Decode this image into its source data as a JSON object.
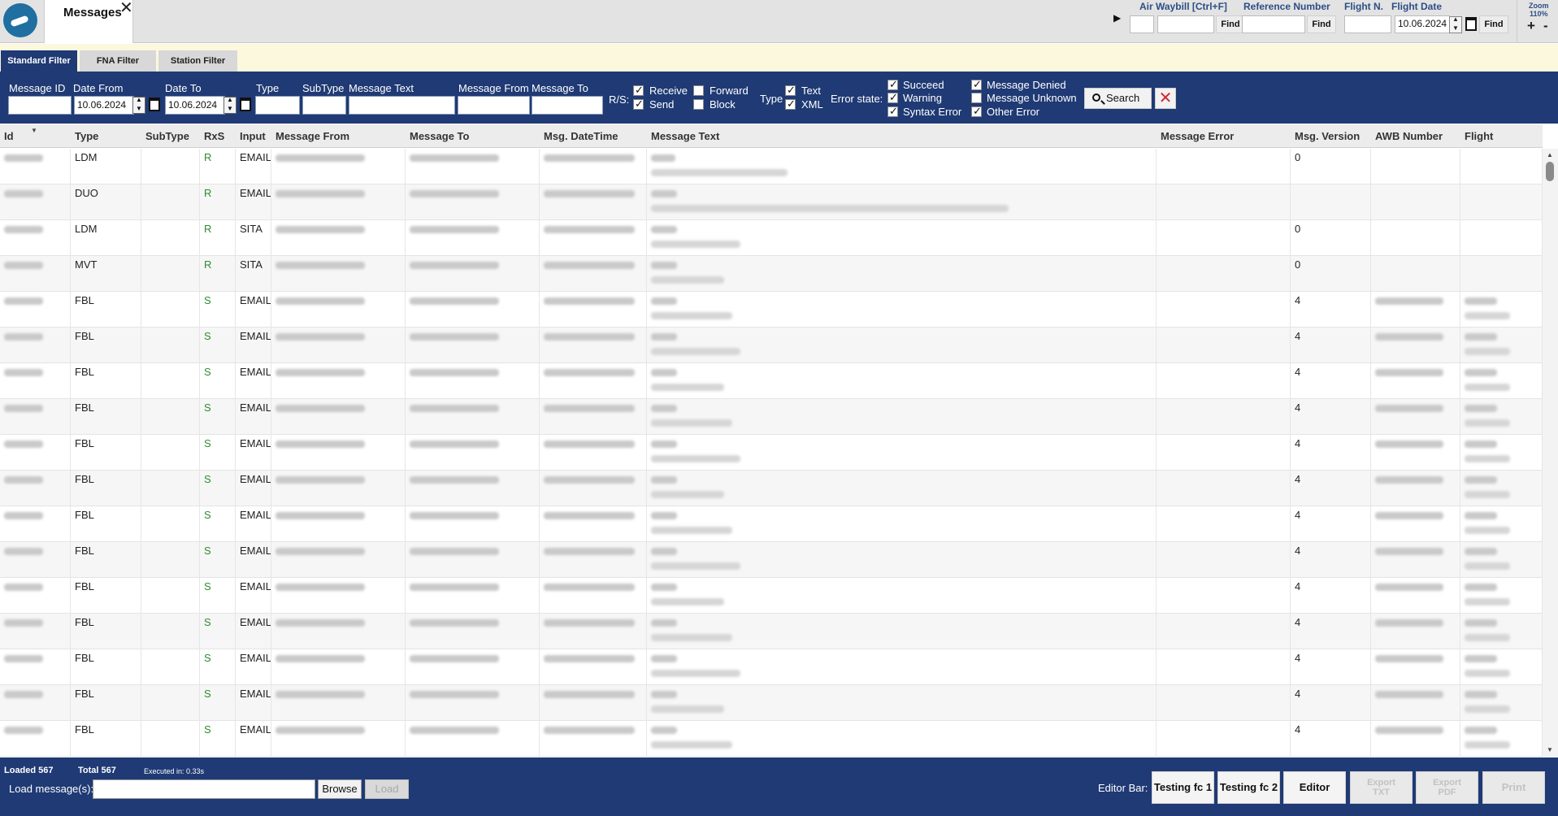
{
  "tab": {
    "title": "Messages",
    "close": "✕"
  },
  "tools": {
    "arrow": "▶",
    "awb_label": "Air Waybill [Ctrl+F]",
    "ref_label": "Reference Number",
    "flight_no_label": "Flight N.",
    "flight_date_label": "Flight Date",
    "flight_date_value": "10.06.2024",
    "find": "Find",
    "zoom_label": "Zoom",
    "zoom_value": "110%",
    "zoom_plus": "+",
    "zoom_minus": "-"
  },
  "filter_tabs": [
    "Standard Filter",
    "FNA Filter",
    "Station Filter"
  ],
  "filter": {
    "message_id": "Message ID",
    "date_from": "Date From",
    "date_from_value": "10.06.2024",
    "date_to": "Date To",
    "date_to_value": "10.06.2024",
    "type": "Type",
    "subtype": "SubType",
    "message_text": "Message Text",
    "message_from": "Message From",
    "message_to": "Message To",
    "rs_label": "R/S:",
    "receive": "Receive",
    "send": "Send",
    "forward": "Forward",
    "block": "Block",
    "type_label": "Type",
    "text": "Text",
    "xml": "XML",
    "error_state": "Error state:",
    "succeed": "Succeed",
    "warning": "Warning",
    "syntax_error": "Syntax Error",
    "message_denied": "Message Denied",
    "message_unknown": "Message Unknown",
    "other_error": "Other Error",
    "search": "Search",
    "clear": "✕"
  },
  "checkbox_state": {
    "receive": true,
    "send": true,
    "forward": false,
    "block": false,
    "text": true,
    "xml": true,
    "succeed": true,
    "warning": true,
    "syntax_error": true,
    "message_denied": true,
    "message_unknown": false,
    "other_error": true
  },
  "columns": [
    "Id",
    "Type",
    "SubType",
    "RxS",
    "Input",
    "Message From",
    "Message To",
    "Msg. DateTime",
    "Message Text",
    "Message Error",
    "Msg. Version",
    "AWB Number",
    "Flight"
  ],
  "rows": [
    {
      "type": "LDM",
      "subtype": "",
      "rxs": "R",
      "input": "EMAIL",
      "error": "",
      "version": "0"
    },
    {
      "type": "DUO",
      "subtype": "",
      "rxs": "R",
      "input": "EMAIL",
      "error": "",
      "version": ""
    },
    {
      "type": "LDM",
      "subtype": "",
      "rxs": "R",
      "input": "SITA",
      "error": "",
      "version": "0"
    },
    {
      "type": "MVT",
      "subtype": "",
      "rxs": "R",
      "input": "SITA",
      "error": "",
      "version": "0"
    },
    {
      "type": "FBL",
      "subtype": "",
      "rxs": "S",
      "input": "EMAIL",
      "error": "",
      "version": "4"
    },
    {
      "type": "FBL",
      "subtype": "",
      "rxs": "S",
      "input": "EMAIL",
      "error": "",
      "version": "4"
    },
    {
      "type": "FBL",
      "subtype": "",
      "rxs": "S",
      "input": "EMAIL",
      "error": "",
      "version": "4"
    },
    {
      "type": "FBL",
      "subtype": "",
      "rxs": "S",
      "input": "EMAIL",
      "error": "",
      "version": "4"
    },
    {
      "type": "FBL",
      "subtype": "",
      "rxs": "S",
      "input": "EMAIL",
      "error": "",
      "version": "4"
    },
    {
      "type": "FBL",
      "subtype": "",
      "rxs": "S",
      "input": "EMAIL",
      "error": "",
      "version": "4"
    },
    {
      "type": "FBL",
      "subtype": "",
      "rxs": "S",
      "input": "EMAIL",
      "error": "",
      "version": "4"
    },
    {
      "type": "FBL",
      "subtype": "",
      "rxs": "S",
      "input": "EMAIL",
      "error": "",
      "version": "4"
    },
    {
      "type": "FBL",
      "subtype": "",
      "rxs": "S",
      "input": "EMAIL",
      "error": "",
      "version": "4"
    },
    {
      "type": "FBL",
      "subtype": "",
      "rxs": "S",
      "input": "EMAIL",
      "error": "",
      "version": "4"
    },
    {
      "type": "FBL",
      "subtype": "",
      "rxs": "S",
      "input": "EMAIL",
      "error": "",
      "version": "4"
    },
    {
      "type": "FBL",
      "subtype": "",
      "rxs": "S",
      "input": "EMAIL",
      "error": "",
      "version": "4"
    },
    {
      "type": "FBL",
      "subtype": "",
      "rxs": "S",
      "input": "EMAIL",
      "error": "",
      "version": "4"
    }
  ],
  "footer": {
    "loaded": "Loaded 567",
    "total": "Total 567",
    "executed": "Executed in: 0.33s",
    "load_label": "Load message(s):",
    "browse": "Browse",
    "load": "Load",
    "editor_bar": "Editor Bar:",
    "testing1": "Testing fc 1",
    "testing2": "Testing fc 2",
    "editor": "Editor",
    "export_txt_1": "Export",
    "export_txt_2": "TXT",
    "export_pdf_1": "Export",
    "export_pdf_2": "PDF",
    "print": "Print"
  },
  "icons": {
    "logo": "app-logo-icon",
    "search": "search-icon",
    "calendar": "calendar-icon"
  },
  "colors": {
    "primary": "#1f3a74",
    "header_bg": "#e3e3e3",
    "filter_tabs_bg": "#fcf8dd",
    "rs_green": "#2d8b2d",
    "clear_red": "#d3262f"
  }
}
